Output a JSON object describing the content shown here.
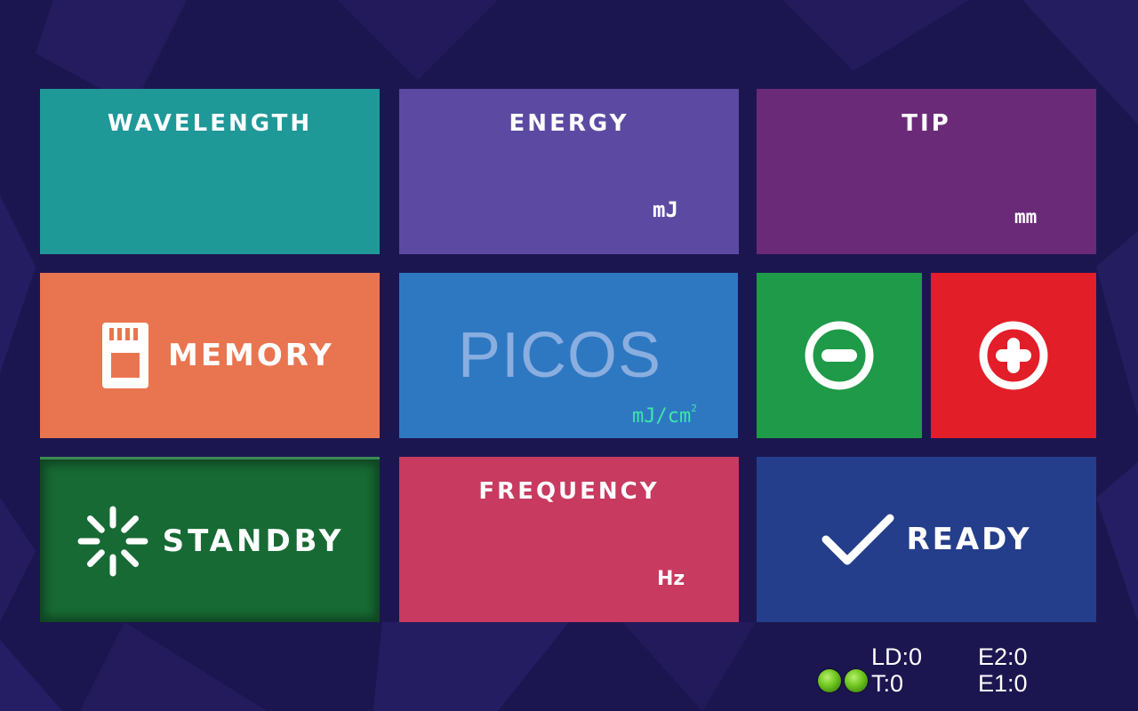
{
  "colors": {
    "background": "#1c1650",
    "wavelength": "#1f9898",
    "energy": "#5c4aa2",
    "tip": "#6b2a78",
    "memory": "#e97550",
    "picos": "#2e78c2",
    "minus": "#1e9a48",
    "plus": "#e21e28",
    "standby": "#176a34",
    "frequency": "#c83a60",
    "ready": "#243e8c",
    "fluence_unit": "#3ee6a8",
    "led": "#6cc41e"
  },
  "tiles": {
    "wavelength": {
      "title": "WAVELENGTH"
    },
    "energy": {
      "title": "ENERGY",
      "unit": "mJ"
    },
    "tip": {
      "title": "TIP",
      "unit": "mm"
    },
    "memory": {
      "label": "MEMORY",
      "icon": "sd-card-icon"
    },
    "picos": {
      "label": "PICOS",
      "unit": "mJ/cm",
      "unit_sup": "2"
    },
    "minus": {
      "icon": "minus-circle-icon"
    },
    "plus": {
      "icon": "plus-circle-icon"
    },
    "standby": {
      "label": "STANDBY",
      "icon": "loading-spinner-icon"
    },
    "frequency": {
      "title": "FREQUENCY",
      "unit": "Hz"
    },
    "ready": {
      "label": "READY",
      "icon": "checkmark-icon"
    }
  },
  "status": {
    "ld": "LD:0",
    "t": "T:0",
    "e2": "E2:0",
    "e1": "E1:0",
    "leds": [
      "green",
      "green"
    ]
  }
}
